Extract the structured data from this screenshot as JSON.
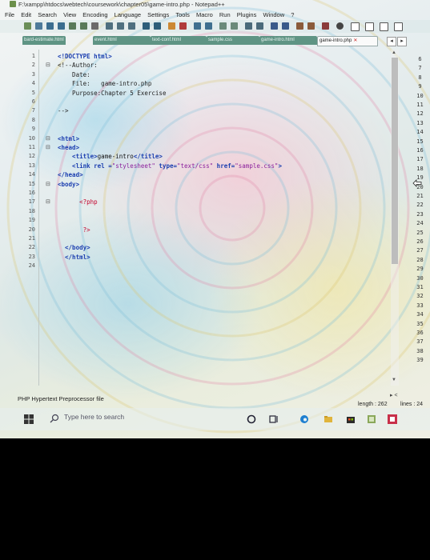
{
  "window": {
    "title": "F:\\xampp\\htdocs\\webtech\\coursework\\chapter05\\game-intro.php - Notepad++"
  },
  "menu": [
    "File",
    "Edit",
    "Search",
    "View",
    "Encoding",
    "Language",
    "Settings",
    "Tools",
    "Macro",
    "Run",
    "Plugins",
    "Window",
    "?"
  ],
  "tabs": [
    {
      "label": "bard-estimate.html"
    },
    {
      "label": "event.html"
    },
    {
      "label": "text-conf.html"
    },
    {
      "label": "sample.css"
    },
    {
      "label": "game-intro.html"
    },
    {
      "label": "game-intro.php",
      "active": true
    }
  ],
  "code_lines": [
    {
      "n": "1",
      "fold": "",
      "segs": [
        [
          "<!DOCTYPE html>",
          "kw"
        ]
      ]
    },
    {
      "n": "2",
      "fold": "⊟",
      "segs": [
        [
          "<!--Author:",
          "cm"
        ]
      ]
    },
    {
      "n": "3",
      "fold": "",
      "segs": [
        [
          "    Date:",
          "cm"
        ]
      ]
    },
    {
      "n": "4",
      "fold": "",
      "segs": [
        [
          "    File:   game-intro.php",
          "cm"
        ]
      ]
    },
    {
      "n": "5",
      "fold": "",
      "segs": [
        [
          "    Purpose:Chapter 5 Exercise",
          "cm"
        ]
      ]
    },
    {
      "n": "6",
      "fold": "",
      "segs": []
    },
    {
      "n": "7",
      "fold": "",
      "segs": [
        [
          "-->",
          "cm"
        ]
      ]
    },
    {
      "n": "8",
      "fold": "",
      "segs": []
    },
    {
      "n": "9",
      "fold": "",
      "segs": []
    },
    {
      "n": "10",
      "fold": "⊟",
      "segs": [
        [
          "<html>",
          "kw"
        ]
      ]
    },
    {
      "n": "11",
      "fold": "⊟",
      "segs": [
        [
          "<head>",
          "kw"
        ]
      ]
    },
    {
      "n": "12",
      "fold": "",
      "segs": [
        [
          "    <title>",
          "kw"
        ],
        [
          "game-intro",
          ""
        ],
        [
          "</title>",
          "kw"
        ]
      ]
    },
    {
      "n": "13",
      "fold": "",
      "segs": [
        [
          "    <link rel =",
          "kw"
        ],
        [
          "\"stylesheet\"",
          "str"
        ],
        [
          " type=",
          "kw"
        ],
        [
          "\"text/css\"",
          "str"
        ],
        [
          " href=",
          "kw"
        ],
        [
          "\"sample.css\"",
          "str"
        ],
        [
          ">",
          "kw"
        ]
      ]
    },
    {
      "n": "14",
      "fold": "",
      "segs": [
        [
          "</head>",
          "kw"
        ]
      ]
    },
    {
      "n": "15",
      "fold": "⊟",
      "segs": [
        [
          "<body>",
          "kw"
        ]
      ]
    },
    {
      "n": "16",
      "fold": "",
      "segs": []
    },
    {
      "n": "17",
      "fold": "⊟",
      "segs": [
        [
          "      <?php",
          "php"
        ]
      ]
    },
    {
      "n": "18",
      "fold": "",
      "segs": []
    },
    {
      "n": "19",
      "fold": "",
      "segs": []
    },
    {
      "n": "20",
      "fold": "",
      "segs": [
        [
          "       ?>",
          "php"
        ]
      ]
    },
    {
      "n": "21",
      "fold": "",
      "segs": []
    },
    {
      "n": "22",
      "fold": "",
      "segs": [
        [
          "  </body>",
          "kw"
        ]
      ]
    },
    {
      "n": "23",
      "fold": "",
      "segs": [
        [
          "  </html>",
          "kw"
        ]
      ]
    },
    {
      "n": "24",
      "fold": "",
      "segs": []
    }
  ],
  "side_numbers": [
    "6",
    "7",
    "8",
    "9",
    "10",
    "11",
    "12",
    "13",
    "14",
    "15",
    "16",
    "17",
    "18",
    "19",
    "20",
    "21",
    "22",
    "23",
    "24",
    "25",
    "26",
    "27",
    "28",
    "29",
    "30",
    "31",
    "32",
    "33",
    "34",
    "35",
    "36",
    "37",
    "38",
    "39"
  ],
  "status": {
    "file_type": "PHP Hypertext Preprocessor file",
    "length": "length : 262",
    "lines": "lines : 24"
  },
  "taskbar": {
    "search_placeholder": "Type here to search"
  }
}
